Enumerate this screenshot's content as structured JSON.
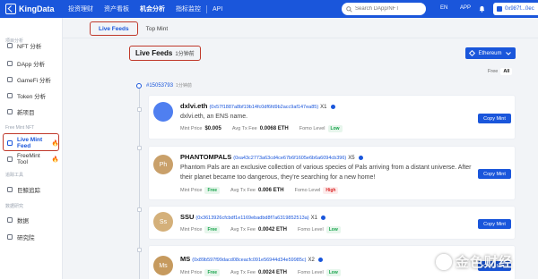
{
  "nav": {
    "brand": "KingData",
    "items": [
      "投资理财",
      "资产看板",
      "机会分析",
      "指标监控",
      "API"
    ],
    "active_index": 2,
    "search_placeholder": "Search DApp/NFT",
    "lang": "EN",
    "app": "APP",
    "wallet": "0x987f...0ec"
  },
  "sidebar": {
    "sections": [
      {
        "title": "项目分析",
        "items": [
          "NFT 分析",
          "DApp 分析",
          "GameFi 分析",
          "Token 分析",
          "新项目"
        ]
      },
      {
        "title": "Free Mint NFT",
        "items": [
          "Live Mint Feed",
          "FreeMint Tool"
        ]
      },
      {
        "title": "追踪工具",
        "items": [
          "巨鲸追踪"
        ]
      },
      {
        "title": "数据研究",
        "items": [
          "数据",
          "研究院"
        ]
      }
    ],
    "active_item": "Live Mint Feed",
    "fire_glyph": "🔥"
  },
  "tabs": [
    "Live Feeds",
    "Top Mint"
  ],
  "active_tab": 0,
  "feed": {
    "title": "Live Feeds",
    "subtitle": "1分钟前",
    "chain": "Ethereum",
    "filters": [
      "Free",
      "All"
    ],
    "active_filter": "All",
    "block": "#15053793",
    "block_ago": "1分钟前"
  },
  "labels": {
    "mint_price": "Mint Price",
    "avg_tx_fee": "Avg Tx Fee",
    "fomo_level": "Fomo Level",
    "copy_mint": "Copy Mint"
  },
  "cards": [
    {
      "name": "dxlvi.eth",
      "address": "(0x57f1887a8bf19b14fc0df6fd9b2acc9af147ea85)",
      "count": "X1",
      "description": "dxlvi.eth, an ENS name.",
      "avatar_text": "",
      "avatar_color": "#4f7ff0",
      "mint_price": "$0.005",
      "mint_price_tag": "",
      "avg_tx_fee": "0.0068 ETH",
      "fomo_level": "Low"
    },
    {
      "name": "PHANTOMPALS",
      "address": "(0xa43c2773a63cd4ce67b6f1605e6b6a6094cb396)",
      "count": "X5",
      "description": "Phantom Pals are an exclusive collection of various species of Pals arriving from a distant universe. After their planet became too dangerous, they're searching for a new home!",
      "avatar_text": "Ph",
      "avatar_color": "#c9a06a",
      "mint_price": "",
      "mint_price_tag": "Free",
      "avg_tx_fee": "0.006 ETH",
      "fomo_level": "High"
    },
    {
      "name": "SSU",
      "address": "(0x3613926cfcbdf1e1169ebadbd8f7a6319852513a)",
      "count": "X1",
      "description": "",
      "avatar_text": "Ss",
      "avatar_color": "#d4b07a",
      "mint_price": "",
      "mint_price_tag": "Free",
      "avg_tx_fee": "0.0042 ETH",
      "fomo_level": "Low"
    },
    {
      "name": "MS",
      "address": "(0x89b597f99dacd08ceacfc091e56944d34e59985c)",
      "count": "X2",
      "description": "",
      "avatar_text": "Ms",
      "avatar_color": "#c69a5e",
      "mint_price": "",
      "mint_price_tag": "Free",
      "avg_tx_fee": "0.0024 ETH",
      "fomo_level": "Low"
    }
  ],
  "watermark": "金色财经"
}
